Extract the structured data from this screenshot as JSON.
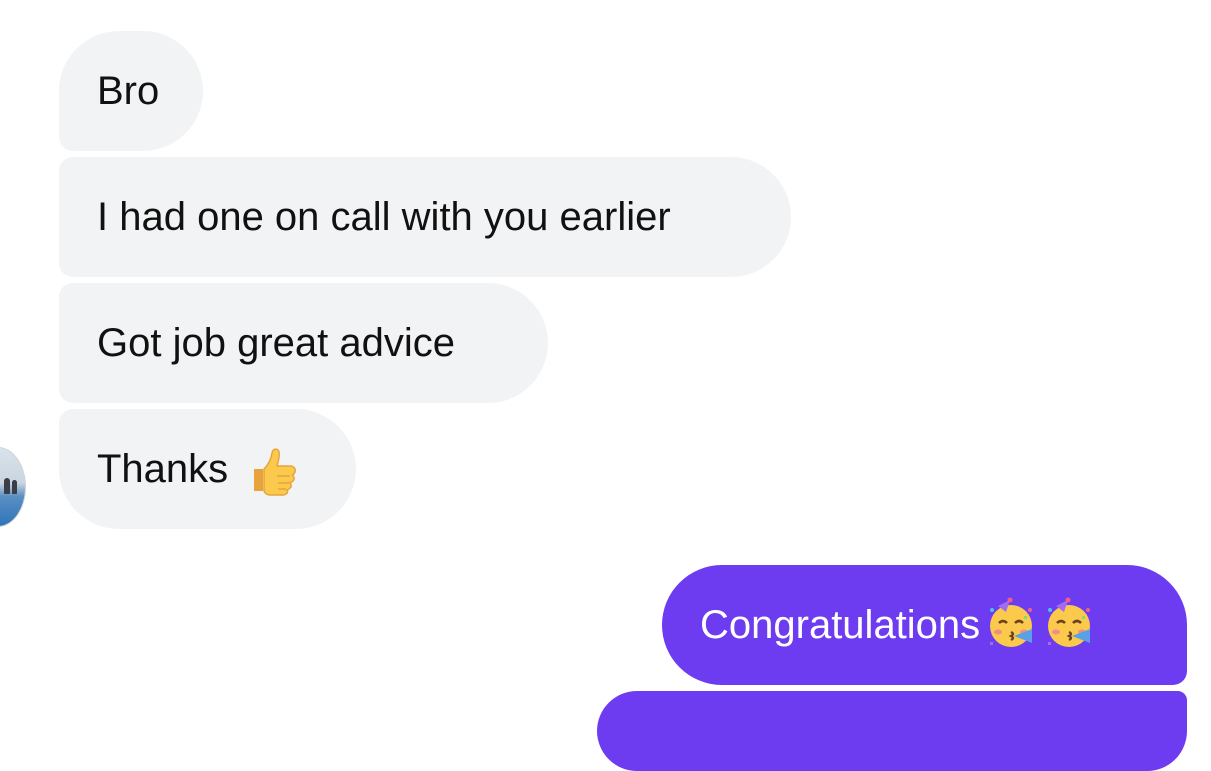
{
  "conversation": {
    "incoming": [
      {
        "text": "Bro"
      },
      {
        "text": "I had one on call with you earlier"
      },
      {
        "text": "Got job great advice"
      },
      {
        "text": "Thanks",
        "emoji": "thumbs-up-icon"
      }
    ],
    "outgoing": [
      {
        "text": "Congratulations",
        "emoji": "partying-face-icon"
      }
    ]
  },
  "colors": {
    "incoming_bubble": "#f2f3f5",
    "outgoing_bubble": "#6e3cf0",
    "incoming_text": "#111111",
    "outgoing_text": "#ffffff"
  }
}
